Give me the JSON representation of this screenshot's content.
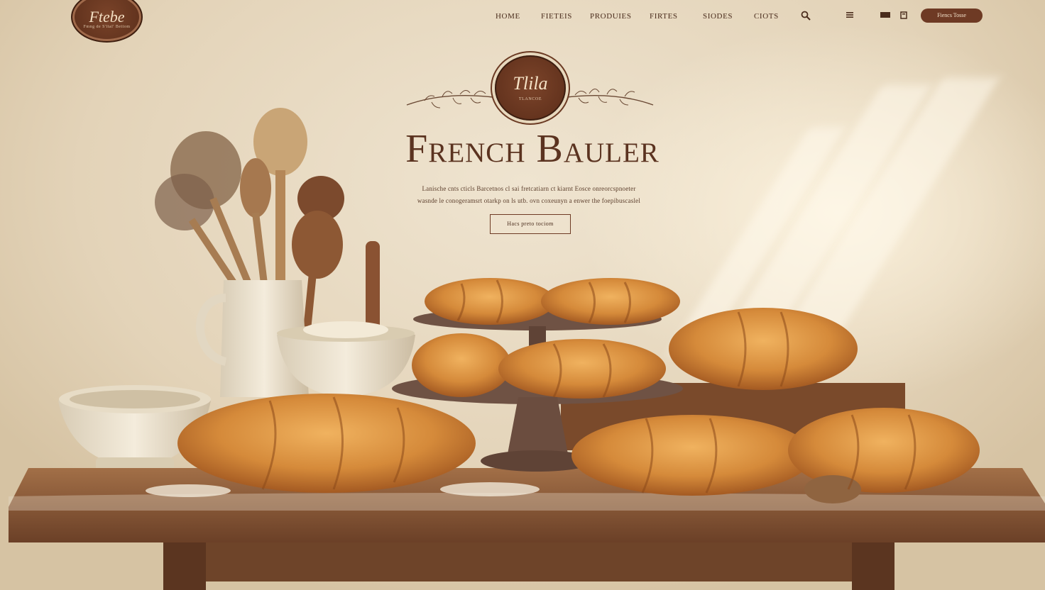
{
  "brand": {
    "logo_script": "Ftebe",
    "logo_sub": "Fmng de S'ltal' Bettom"
  },
  "nav": {
    "items": [
      "HOME",
      "FIETEIS",
      "PRODUIES",
      "FIRTES",
      "SIODES",
      "CIOTS"
    ],
    "search_icon": "search-icon",
    "menu_icon": "menu-icon",
    "chat_icon": "chat-icon",
    "bag_icon": "bag-icon",
    "cta_label": "Fiencs Tosse"
  },
  "hero": {
    "emblem_script": "Tlila",
    "emblem_sub": "TLANCOE",
    "title": "French Bauler",
    "text_line1": "Lanische cnts cticls Barcetnos cl sai fretcatiarn ct kiarnt Eosce onreorcspnoeter",
    "text_line2": "wasnde le conogeramsrt otarkp on ls utb. ovn coxeunyn a enwer the foepibuscaslel",
    "button_label": "Hacs preto tociom"
  },
  "colors": {
    "accent": "#6e3a24",
    "text": "#4a2c1c",
    "wall": "#e9dcc5",
    "wood": "#8a5a38"
  }
}
